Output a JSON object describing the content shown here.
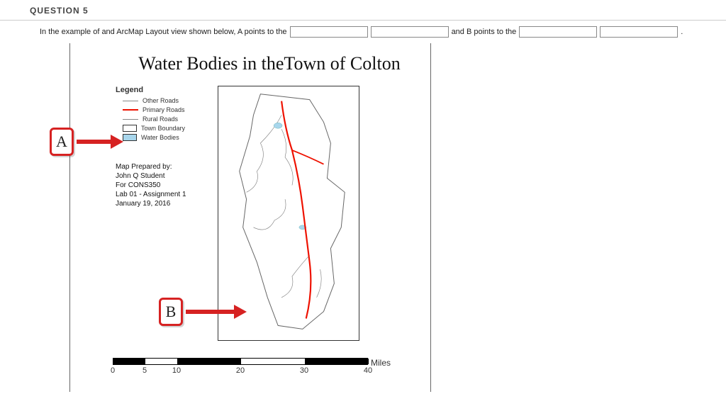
{
  "question": {
    "label": "QUESTION 5",
    "prompt_part1": "In the example of and ArcMap Layout view shown below, A points to the",
    "prompt_part2": "and B points to the",
    "period": "."
  },
  "inputs": {
    "a1": "",
    "a2": "",
    "b1": "",
    "b2": ""
  },
  "callouts": {
    "a": "A",
    "b": "B"
  },
  "map": {
    "title": "Water Bodies in theTown of Colton",
    "legend_title": "Legend",
    "legend": [
      {
        "label": "Other Roads",
        "type": "line-gray"
      },
      {
        "label": "Primary Roads",
        "type": "line-red"
      },
      {
        "label": "Rural Roads",
        "type": "line-gray"
      },
      {
        "label": "Town Boundary",
        "type": "box-white"
      },
      {
        "label": "Water Bodies",
        "type": "box-blue"
      }
    ],
    "credits": {
      "l1": "Map Prepared by:",
      "l2": "John Q Student",
      "l3": "For CONS350",
      "l4": "Lab 01 - Assignment 1",
      "l5": "January 19, 2016"
    },
    "scale": {
      "unit": "Miles",
      "ticks": [
        "0",
        "5",
        "10",
        "20",
        "30",
        "40"
      ]
    }
  }
}
